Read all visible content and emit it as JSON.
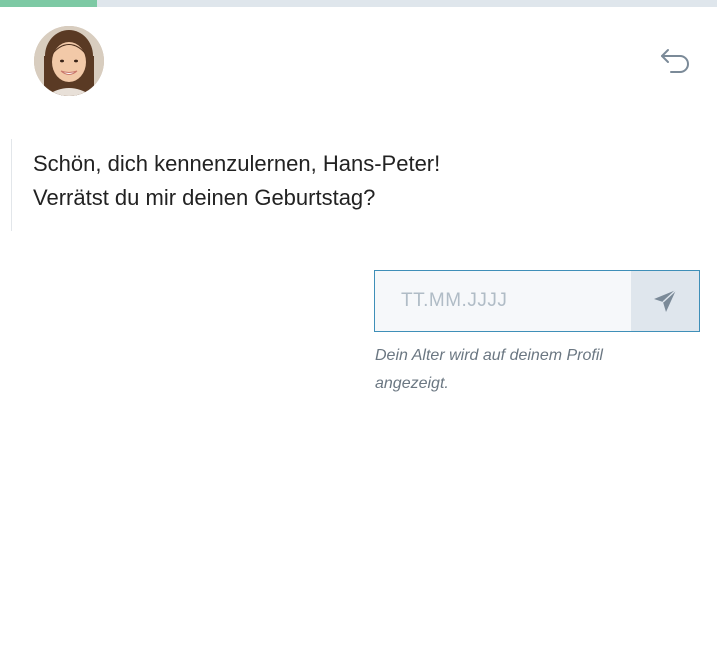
{
  "progress": {
    "fraction": 0.135,
    "fill_color": "#7dc9a4",
    "track_color": "#dfe6ec"
  },
  "header": {
    "avatar_icon": "woman-portrait-avatar",
    "back_icon": "undo-arrow-icon"
  },
  "chat": {
    "message_lines": [
      "Schön, dich kennenzulernen, Hans-Peter!",
      "Verrätst du mir deinen Geburtstag?"
    ]
  },
  "birthday_form": {
    "placeholder": "TT.MM.JJJJ",
    "value": "",
    "send_icon": "paper-plane-send-icon",
    "accent_color": "#3f8fb8",
    "hint": "Dein Alter wird auf deinem Profil angezeigt."
  }
}
